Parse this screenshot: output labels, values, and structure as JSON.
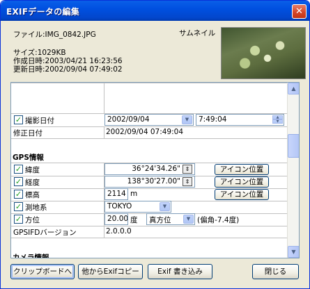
{
  "window": {
    "title": "EXIFデータの編集",
    "close_label": "✕"
  },
  "file": {
    "name": "ファイル:IMG_0842.JPG",
    "size": "サイズ:1029KB",
    "created": "作成日時:2003/04/21 16:23:56",
    "modified": "更新日時:2002/09/04 07:49:02"
  },
  "thumbnail": {
    "label": "サムネイル"
  },
  "rows": {
    "shoot_date": {
      "label": "撮影日付",
      "date": "2002/09/04",
      "time": "7:49:04",
      "checked": true
    },
    "mod_date": {
      "label": "修正日付",
      "value": "2002/09/04 07:49:04"
    }
  },
  "gps": {
    "section_title": "GPS情報",
    "latitude": {
      "label": "緯度",
      "value": "36°24'34.26\"",
      "button": "アイコン位置",
      "checked": true
    },
    "longitude": {
      "label": "経度",
      "value": "138°30'27.00\"",
      "button": "アイコン位置",
      "checked": true
    },
    "altitude": {
      "label": "標高",
      "value": "2114",
      "unit": "m",
      "button": "アイコン位置",
      "checked": true
    },
    "datum": {
      "label": "測地系",
      "value": "TOKYO",
      "checked": true
    },
    "direction": {
      "label": "方位",
      "value": "20.00",
      "unit": "度",
      "ref": "真方位",
      "note": "(偏角-7.4度)",
      "checked": true
    },
    "version": {
      "label": "GPSIFDバージョン",
      "value": "2.0.0.0"
    }
  },
  "camera": {
    "section_title": "カメラ情報"
  },
  "buttons": {
    "clipboard": "クリップボードへ",
    "copy_from": "他からExifコピー",
    "write": "Exif 書き込み",
    "close": "閉じる"
  },
  "icons": {
    "spin_up": "up-arrow",
    "spin_down": "down-arrow",
    "dropdown": "chevron-down",
    "check": "check"
  }
}
